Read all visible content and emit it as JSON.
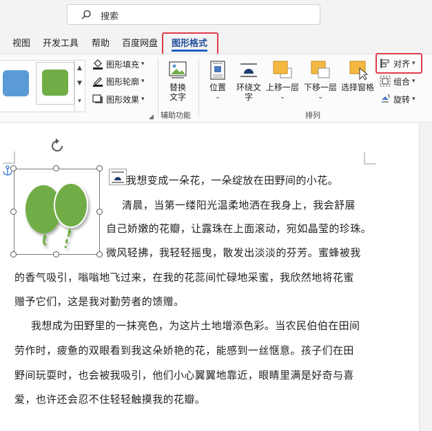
{
  "search": {
    "placeholder": "搜索"
  },
  "tabs": [
    {
      "label": "视图"
    },
    {
      "label": "开发工具"
    },
    {
      "label": "帮助"
    },
    {
      "label": "百度网盘"
    },
    {
      "label": "图形格式"
    }
  ],
  "ribbon": {
    "shape_styles": {
      "fill_label": "图形填充",
      "outline_label": "图形轮廓",
      "effects_label": "图形效果"
    },
    "accessibility": {
      "alt_text_label_line1": "替换",
      "alt_text_label_line2": "文字",
      "group_label": "辅助功能"
    },
    "arrange": {
      "position_label": "位置",
      "wrap_text_line1": "环绕文",
      "wrap_text_line2": "字",
      "bring_forward_label": "上移一层",
      "send_backward_label": "下移一层",
      "selection_pane_label": "选择窗格",
      "align_label": "对齐",
      "group_label": "组合",
      "rotate_label": "旋转",
      "section_label": "排列"
    },
    "colors": {
      "blue_swatch": "#5b9bd5",
      "green_swatch": "#70ad47",
      "highlight": "#e0394b",
      "active_tab_text": "#1f4e9c"
    }
  },
  "document": {
    "lines": [
      "我想变成一朵花，一朵绽放在田野间的小花。",
      "清晨，当第一缕阳光温柔地洒在我身上，我会舒展",
      "自己娇嫩的花瓣，让露珠在上面滚动，宛如晶莹的珍珠。",
      "微风轻拂，我轻轻摇曳，散发出淡淡的芬芳。蜜蜂被我",
      "的香气吸引，嗡嗡地飞过来，在我的花蕊间忙碌地采蜜，我欣然地将花蜜",
      "赠予它们，这是我对勤劳者的馈赠。",
      "我想成为田野里的一抹亮色，为这片土地增添色彩。当农民伯伯在田间",
      "劳作时，疲惫的双眼看到我这朵娇艳的花，能感到一丝惬意。孩子们在田",
      "野间玩耍时，也会被我吸引，他们小心翼翼地靠近，眼睛里满是好奇与喜",
      "爱，也许还会忍不住轻轻触摸我的花瓣。"
    ],
    "shape": {
      "icon": "balloons-icon",
      "color": "#70ad47"
    }
  }
}
